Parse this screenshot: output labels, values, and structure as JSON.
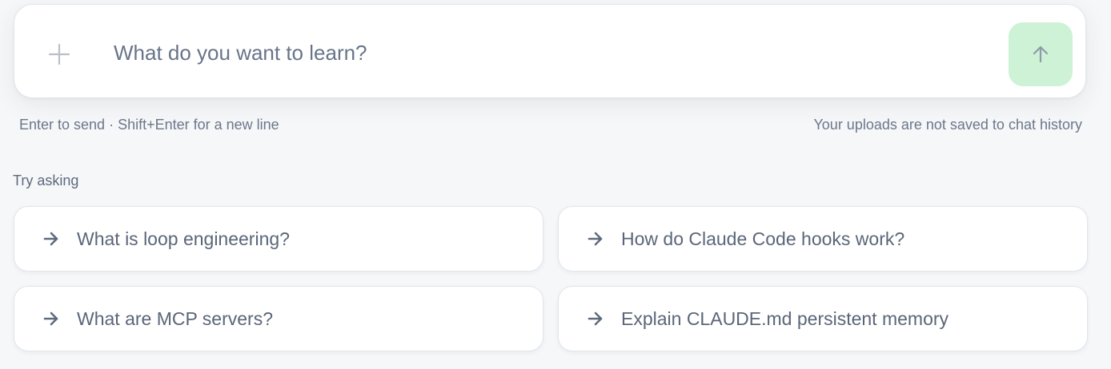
{
  "composer": {
    "placeholder": "What do you want to learn?",
    "attach_icon": "plus-icon",
    "send_icon": "arrow-up-icon",
    "send_button_color": "#cdf2d6"
  },
  "hints": {
    "left": "Enter to send · Shift+Enter for a new line",
    "right": "Your uploads are not saved to chat history"
  },
  "suggestions": {
    "label": "Try asking",
    "icon": "arrow-right-icon",
    "items": [
      {
        "text": "What is loop engineering?"
      },
      {
        "text": "How do Claude Code hooks work?"
      },
      {
        "text": "What are MCP servers?"
      },
      {
        "text": "Explain CLAUDE.md persistent memory"
      }
    ]
  }
}
